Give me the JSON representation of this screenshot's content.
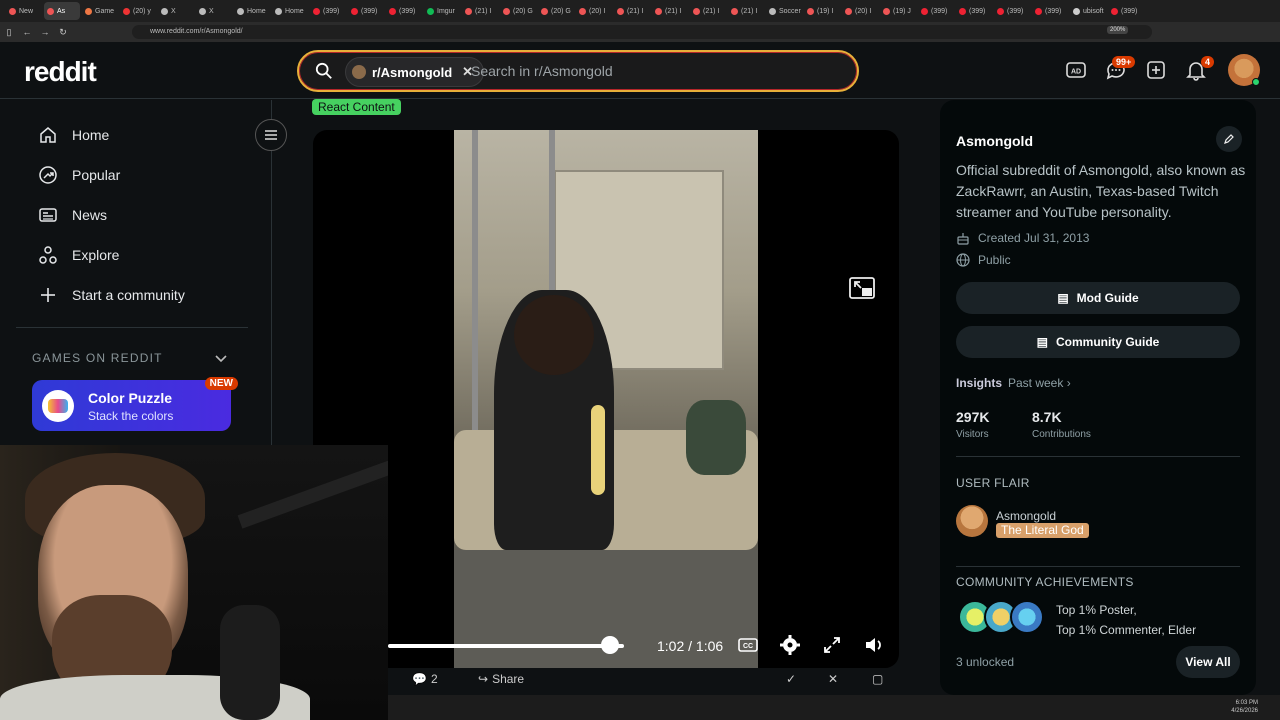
{
  "browser": {
    "tabs": [
      "New",
      "As",
      "Game",
      "(20) y",
      "X",
      "X",
      "Home",
      "Home",
      "(399)",
      "(399)",
      "(399)",
      "Imgur",
      "(21) I",
      "(20) G",
      "(20) G",
      "(20) I",
      "(21) I",
      "(21) I",
      "(21) I",
      "(21) I",
      "Soccer",
      "(19) I",
      "(20) I",
      "(19) J",
      "(399)",
      "(399)",
      "(399)",
      "(399)",
      "ubisoft",
      "(399)"
    ],
    "url": "www.reddit.com/r/Asmongold/",
    "zoom": "200%"
  },
  "header": {
    "logo": "reddit",
    "chip_label": "r/Asmongold",
    "search_placeholder": "Search in r/Asmongold",
    "chat_badge": "99+",
    "notif_badge": "4"
  },
  "leftnav": {
    "items": [
      {
        "label": "Home",
        "icon": "home-icon"
      },
      {
        "label": "Popular",
        "icon": "popular-icon"
      },
      {
        "label": "News",
        "icon": "news-icon"
      },
      {
        "label": "Explore",
        "icon": "explore-icon"
      },
      {
        "label": "Start a community",
        "icon": "plus-icon"
      }
    ],
    "games_heading": "GAMES ON REDDIT",
    "game": {
      "title": "Color Puzzle",
      "subtitle": "Stack the colors",
      "badge": "NEW"
    }
  },
  "post": {
    "flair": "React Content",
    "time": "1:02 / 1:06",
    "progress": 0.94,
    "comments": "2",
    "share": "Share"
  },
  "sidebar": {
    "title": "Asmongold",
    "description": "Official subreddit of Asmongold, also known as ZackRawrr, an Austin, Texas-based Twitch streamer and YouTube personality.",
    "created": "Created Jul 31, 2013",
    "visibility": "Public",
    "mod_guide": "Mod Guide",
    "community_guide": "Community Guide",
    "insights": "Insights",
    "insights_period": "Past week",
    "visitors_value": "297K",
    "visitors_label": "Visitors",
    "contrib_value": "8.7K",
    "contrib_label": "Contributions",
    "user_flair_heading": "USER FLAIR",
    "user_name": "Asmongold",
    "user_flair": "The Literal God",
    "achievements_heading": "COMMUNITY ACHIEVEMENTS",
    "achievement_1": "Top 1% Poster,",
    "achievement_2": "Top 1% Commenter, Elder",
    "unlocked": "3 unlocked",
    "view_all": "View All"
  },
  "taskbar": {
    "time": "6:03 PM",
    "date": "4/26/2026"
  },
  "colors": {
    "accent": "#d93a00",
    "flair_green": "#46d160",
    "search_border": "#e8b03a"
  }
}
